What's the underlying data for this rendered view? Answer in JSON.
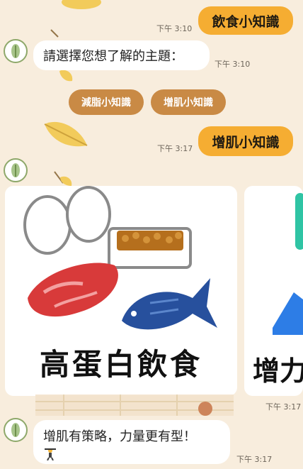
{
  "messages": {
    "msg1": {
      "text": "飲食小知識",
      "time": "下午 3:10"
    },
    "msg2": {
      "text": "請選擇您想了解的主題：",
      "time": "下午 3:10"
    },
    "msg3": {
      "text": "增肌小知識",
      "time": "下午 3:17"
    },
    "msg4": {
      "text": "增肌有策略，力量更有型！",
      "time": "下午 3:17"
    }
  },
  "quick_replies": {
    "fat_loss": "減脂小知識",
    "muscle_gain": "增肌小知識"
  },
  "carousel": {
    "card1": {
      "title": "高蛋白飲食"
    },
    "card2": {
      "title": "增力"
    },
    "time": "下午 3:17"
  }
}
